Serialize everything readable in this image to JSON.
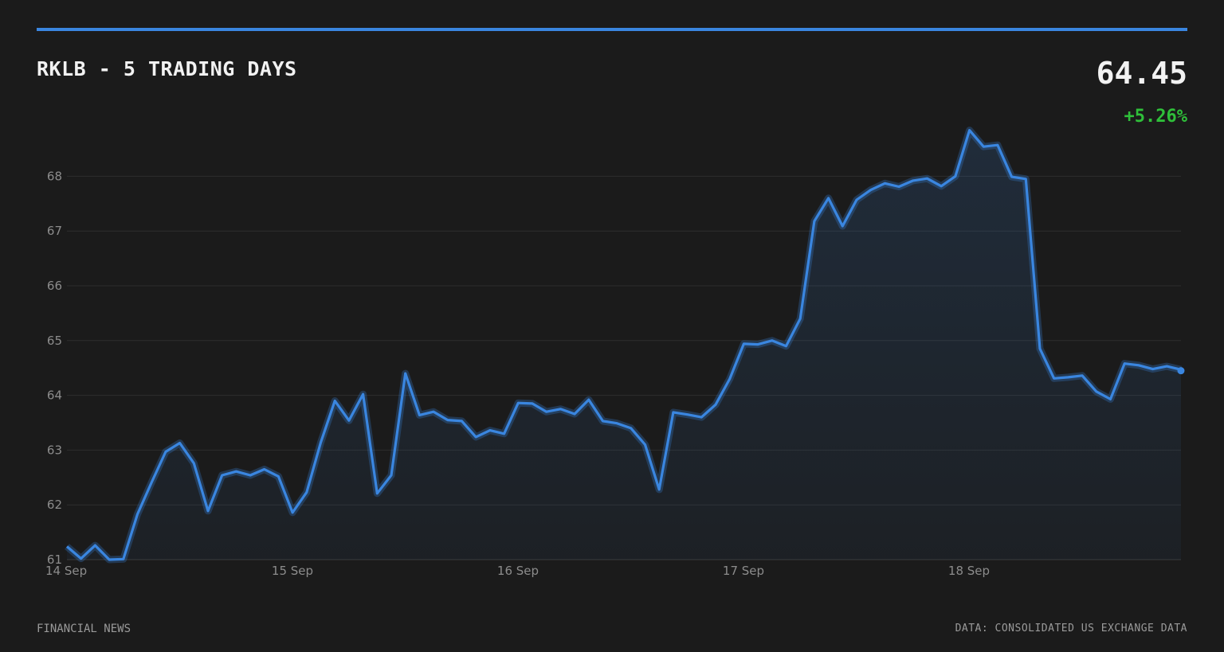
{
  "header": {
    "title": "RKLB - 5 TRADING DAYS",
    "price": "64.45",
    "change": "+5.26%"
  },
  "footer": {
    "source_left": "FINANCIAL NEWS",
    "source_right": "DATA: CONSOLIDATED US EXCHANGE DATA"
  },
  "colors": {
    "accent": "#3a86e0",
    "positive": "#2fbf3a",
    "background": "#1b1b1b"
  },
  "chart_data": {
    "type": "area",
    "ylim": [
      61,
      68.8
    ],
    "yticks": [
      61,
      62,
      63,
      64,
      65,
      66,
      67,
      68
    ],
    "xlim": [
      0,
      98.8
    ],
    "xticks": [
      {
        "x": 0,
        "label": "14 Sep"
      },
      {
        "x": 20,
        "label": "15 Sep"
      },
      {
        "x": 40,
        "label": "16 Sep"
      },
      {
        "x": 60,
        "label": "17 Sep"
      },
      {
        "x": 80,
        "label": "18 Sep"
      }
    ],
    "grid": true,
    "values": [
      61.24,
      61.02,
      61.26,
      61.0,
      61.01,
      61.83,
      62.41,
      62.97,
      63.13,
      62.76,
      61.89,
      62.54,
      62.61,
      62.54,
      62.65,
      62.52,
      61.86,
      62.23,
      63.14,
      63.9,
      63.54,
      64.02,
      62.21,
      62.54,
      64.4,
      63.64,
      63.7,
      63.55,
      63.53,
      63.24,
      63.36,
      63.3,
      63.86,
      63.85,
      63.7,
      63.75,
      63.66,
      63.92,
      63.53,
      63.49,
      63.4,
      63.1,
      62.28,
      63.69,
      63.65,
      63.6,
      63.83,
      64.3,
      64.94,
      64.93,
      65.0,
      64.9,
      65.4,
      67.18,
      67.6,
      67.09,
      67.57,
      67.75,
      67.87,
      67.81,
      67.92,
      67.96,
      67.82,
      68.0,
      68.84,
      68.54,
      68.57,
      67.99,
      67.95,
      64.85,
      64.31,
      64.33,
      64.36,
      64.07,
      63.93,
      64.58,
      64.55,
      64.48,
      64.53,
      64.47
    ],
    "last_value": 64.45
  }
}
